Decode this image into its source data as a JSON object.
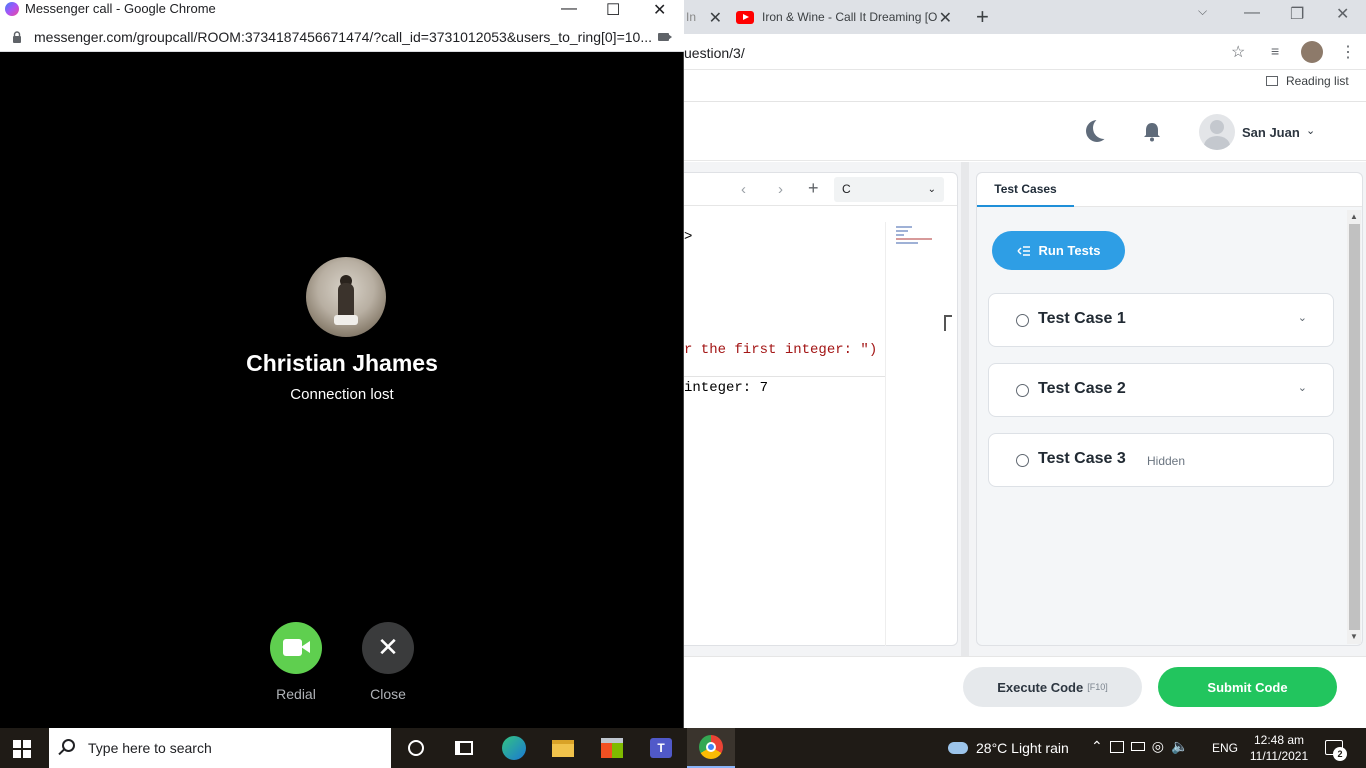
{
  "background_window": {
    "tabs": [
      {
        "label": "In"
      },
      {
        "label": "Iron & Wine - Call It Dreaming [O"
      }
    ],
    "omnibox": "uestion/3/",
    "reading_list": "Reading list",
    "user": {
      "name": "San Juan"
    },
    "editor": {
      "language": "C",
      "code_lines": [
        {
          "text": ">",
          "color": "#202124"
        },
        {
          "text": "r the first integer: \")",
          "color": "#a31515"
        },
        {
          "text": "integer: 7",
          "color": "#202124"
        }
      ]
    },
    "tests": {
      "tab": "Test Cases",
      "run_button": "Run Tests",
      "cases": [
        {
          "title": "Test Case 1",
          "expandable": true,
          "tag": ""
        },
        {
          "title": "Test Case 2",
          "expandable": true,
          "tag": ""
        },
        {
          "title": "Test Case 3",
          "expandable": false,
          "tag": "Hidden"
        }
      ]
    },
    "footer": {
      "execute_label": "Execute Code",
      "execute_shortcut": "[F10]",
      "submit_label": "Submit Code"
    }
  },
  "call_window": {
    "title": "Messenger call - Google Chrome",
    "url": "messenger.com/groupcall/ROOM:3734187456671474/?call_id=3731012053&users_to_ring[0]=10...",
    "caller_name": "Christian Jhames",
    "status": "Connection lost",
    "actions": {
      "redial_label": "Redial",
      "close_label": "Close"
    }
  },
  "taskbar": {
    "search_placeholder": "Type here to search",
    "weather": "28°C  Light rain",
    "language": "ENG",
    "time": "12:48 am",
    "date": "11/11/2021",
    "notification_count": "2"
  },
  "colors": {
    "run_tests": "#2e9ee5",
    "submit": "#22c55e",
    "redial": "#5fcf4f"
  }
}
